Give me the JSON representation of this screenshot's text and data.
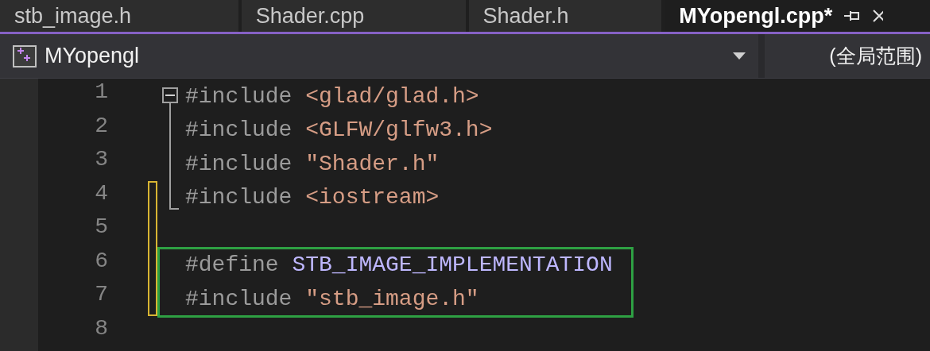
{
  "tabs": [
    {
      "label": "stb_image.h",
      "selected": false
    },
    {
      "label": "Shader.cpp",
      "selected": false
    },
    {
      "label": "Shader.h",
      "selected": false
    },
    {
      "label": "MYopengl.cpp*",
      "selected": true
    }
  ],
  "navigation_bar": {
    "project": "MYopengl",
    "scope": "(全局范围)"
  },
  "editor": {
    "lines": [
      {
        "number": "1",
        "changed": false,
        "boxed": false,
        "folded_block": true,
        "tokens": [
          {
            "kind": "directive",
            "text": "#include"
          },
          {
            "kind": "header",
            "text": "<glad/glad.h>"
          }
        ]
      },
      {
        "number": "2",
        "changed": false,
        "boxed": false,
        "folded_block": true,
        "tokens": [
          {
            "kind": "directive",
            "text": "#include"
          },
          {
            "kind": "header",
            "text": "<GLFW/glfw3.h>"
          }
        ]
      },
      {
        "number": "3",
        "changed": false,
        "boxed": false,
        "folded_block": true,
        "tokens": [
          {
            "kind": "directive",
            "text": "#include"
          },
          {
            "kind": "header",
            "text": "\"Shader.h\""
          }
        ]
      },
      {
        "number": "4",
        "changed": true,
        "boxed": false,
        "folded_block": true,
        "tokens": [
          {
            "kind": "directive",
            "text": "#include"
          },
          {
            "kind": "header",
            "text": "<iostream>"
          }
        ]
      },
      {
        "number": "5",
        "changed": true,
        "boxed": false,
        "folded_block": false
      },
      {
        "number": "6",
        "changed": true,
        "boxed": true,
        "folded_block": false,
        "tokens": [
          {
            "kind": "directive",
            "text": "#define"
          },
          {
            "kind": "macro",
            "text": "STB_IMAGE_IMPLEMENTATION"
          }
        ]
      },
      {
        "number": "7",
        "changed": true,
        "boxed": true,
        "folded_block": false,
        "tokens": [
          {
            "kind": "directive",
            "text": "#include"
          },
          {
            "kind": "header",
            "text": "\"stb_image.h\""
          }
        ]
      },
      {
        "number": "8",
        "changed": false,
        "boxed": false,
        "folded_block": false
      }
    ]
  }
}
